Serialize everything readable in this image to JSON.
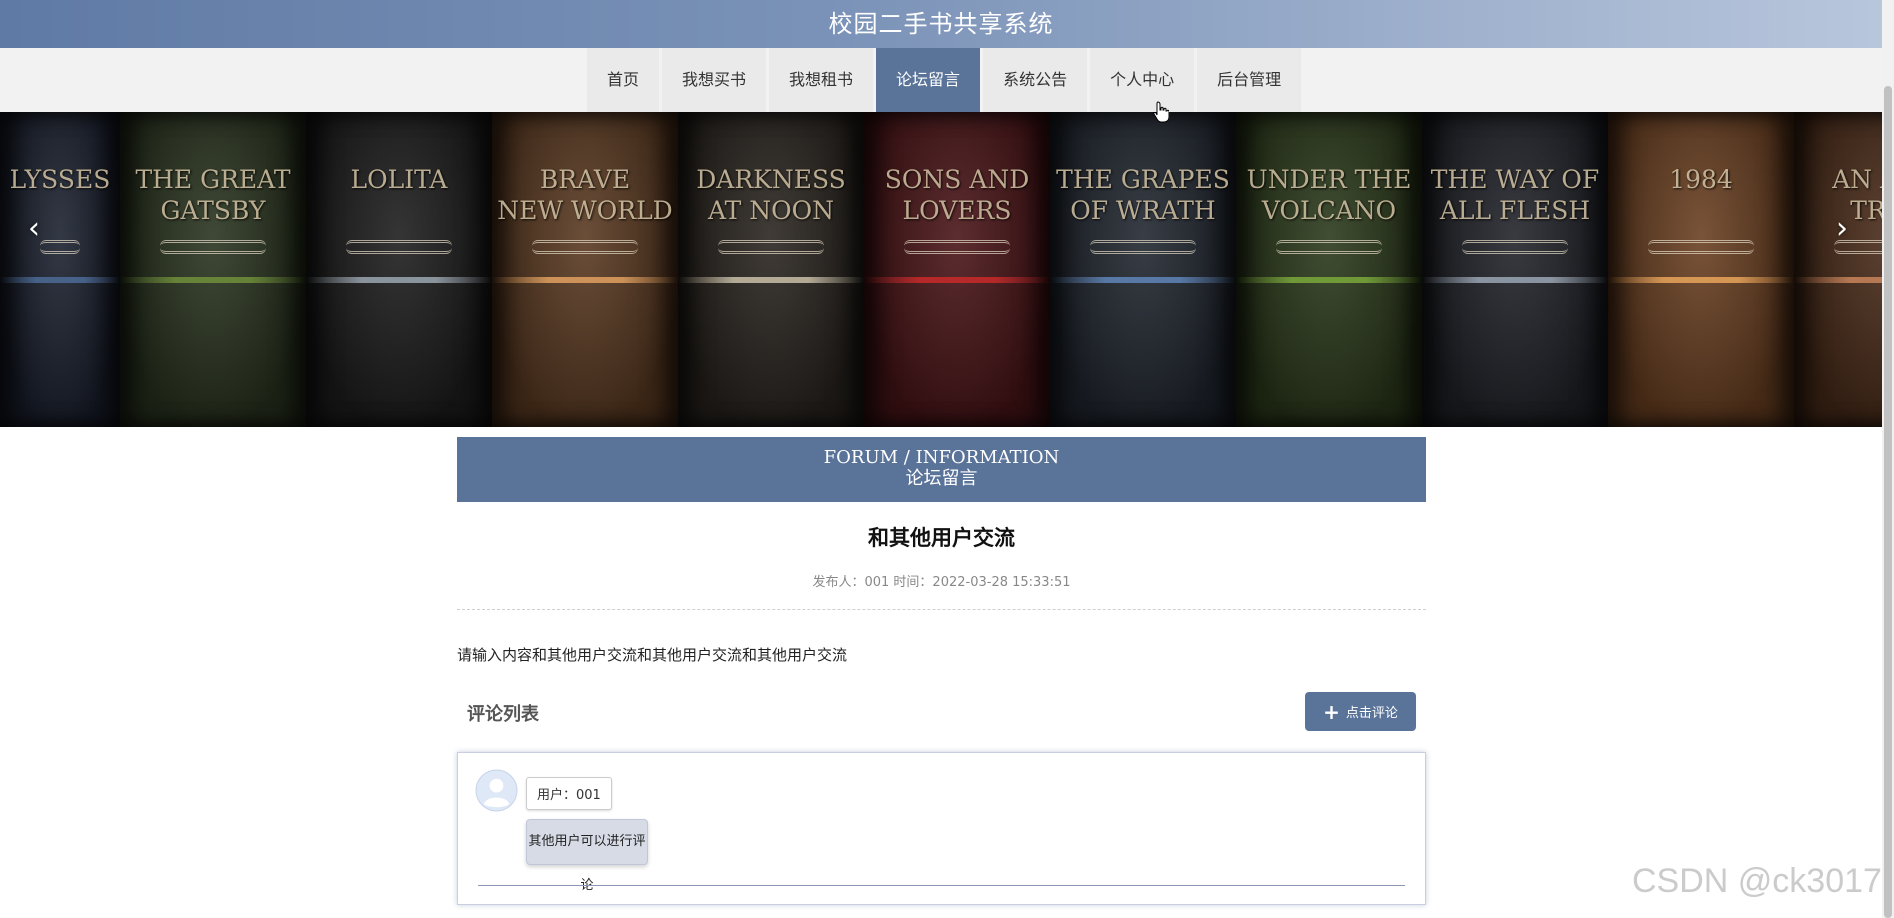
{
  "site": {
    "title": "校园二手书共享系统"
  },
  "nav": {
    "items": [
      {
        "label": "首页",
        "active": false
      },
      {
        "label": "我想买书",
        "active": false
      },
      {
        "label": "我想租书",
        "active": false
      },
      {
        "label": "论坛留言",
        "active": true
      },
      {
        "label": "系统公告",
        "active": false
      },
      {
        "label": "个人中心",
        "active": false
      },
      {
        "label": "后台管理",
        "active": false
      }
    ]
  },
  "banner": {
    "prev_icon": "chevron-left-icon",
    "next_icon": "chevron-right-icon",
    "books": [
      {
        "title": "LYSSES",
        "color": "#1c2230",
        "band": "#4c6a96"
      },
      {
        "title": "THE GREAT\nGATSBY",
        "color": "#2a3420",
        "band": "#6f8f3a"
      },
      {
        "title": "LOLITA",
        "color": "#1e1e1e",
        "band": "#9aa6b0"
      },
      {
        "title": "BRAVE\nNEW WORLD",
        "color": "#5a3a22",
        "band": "#e0a060"
      },
      {
        "title": "DARKNESS\nAT NOON",
        "color": "#2a2520",
        "band": "#c9c0a8"
      },
      {
        "title": "SONS AND\nLOVERS",
        "color": "#4a1518",
        "band": "#c82a2a"
      },
      {
        "title": "THE GRAPES\nOF WRATH",
        "color": "#222831",
        "band": "#5f84b8"
      },
      {
        "title": "UNDER THE\nVOLCANO",
        "color": "#2c3a1c",
        "band": "#7aa83a"
      },
      {
        "title": "THE WAY OF\nALL FLESH",
        "color": "#22242a",
        "band": "#9aa6b4"
      },
      {
        "title": "1984",
        "color": "#6a4022",
        "band": "#e8a45a"
      },
      {
        "title": "AN AME\nTRAG",
        "color": "#4a2c1a",
        "band": "#c8845a"
      }
    ]
  },
  "forum": {
    "heading_en": "FORUM / INFORMATION",
    "heading_cn": "论坛留言",
    "post_title": "和其他用户交流",
    "post_meta": "发布人：001 时间：2022-03-28 15:33:51",
    "post_content": "请输入内容和其他用户交流和其他用户交流和其他用户交流"
  },
  "comments": {
    "label": "评论列表",
    "add_button": "点击评论",
    "add_icon": "plus-icon",
    "items": [
      {
        "user": "用户：001",
        "text": "其他用户可以进行评论"
      }
    ]
  },
  "watermark": "CSDN @ck3017"
}
